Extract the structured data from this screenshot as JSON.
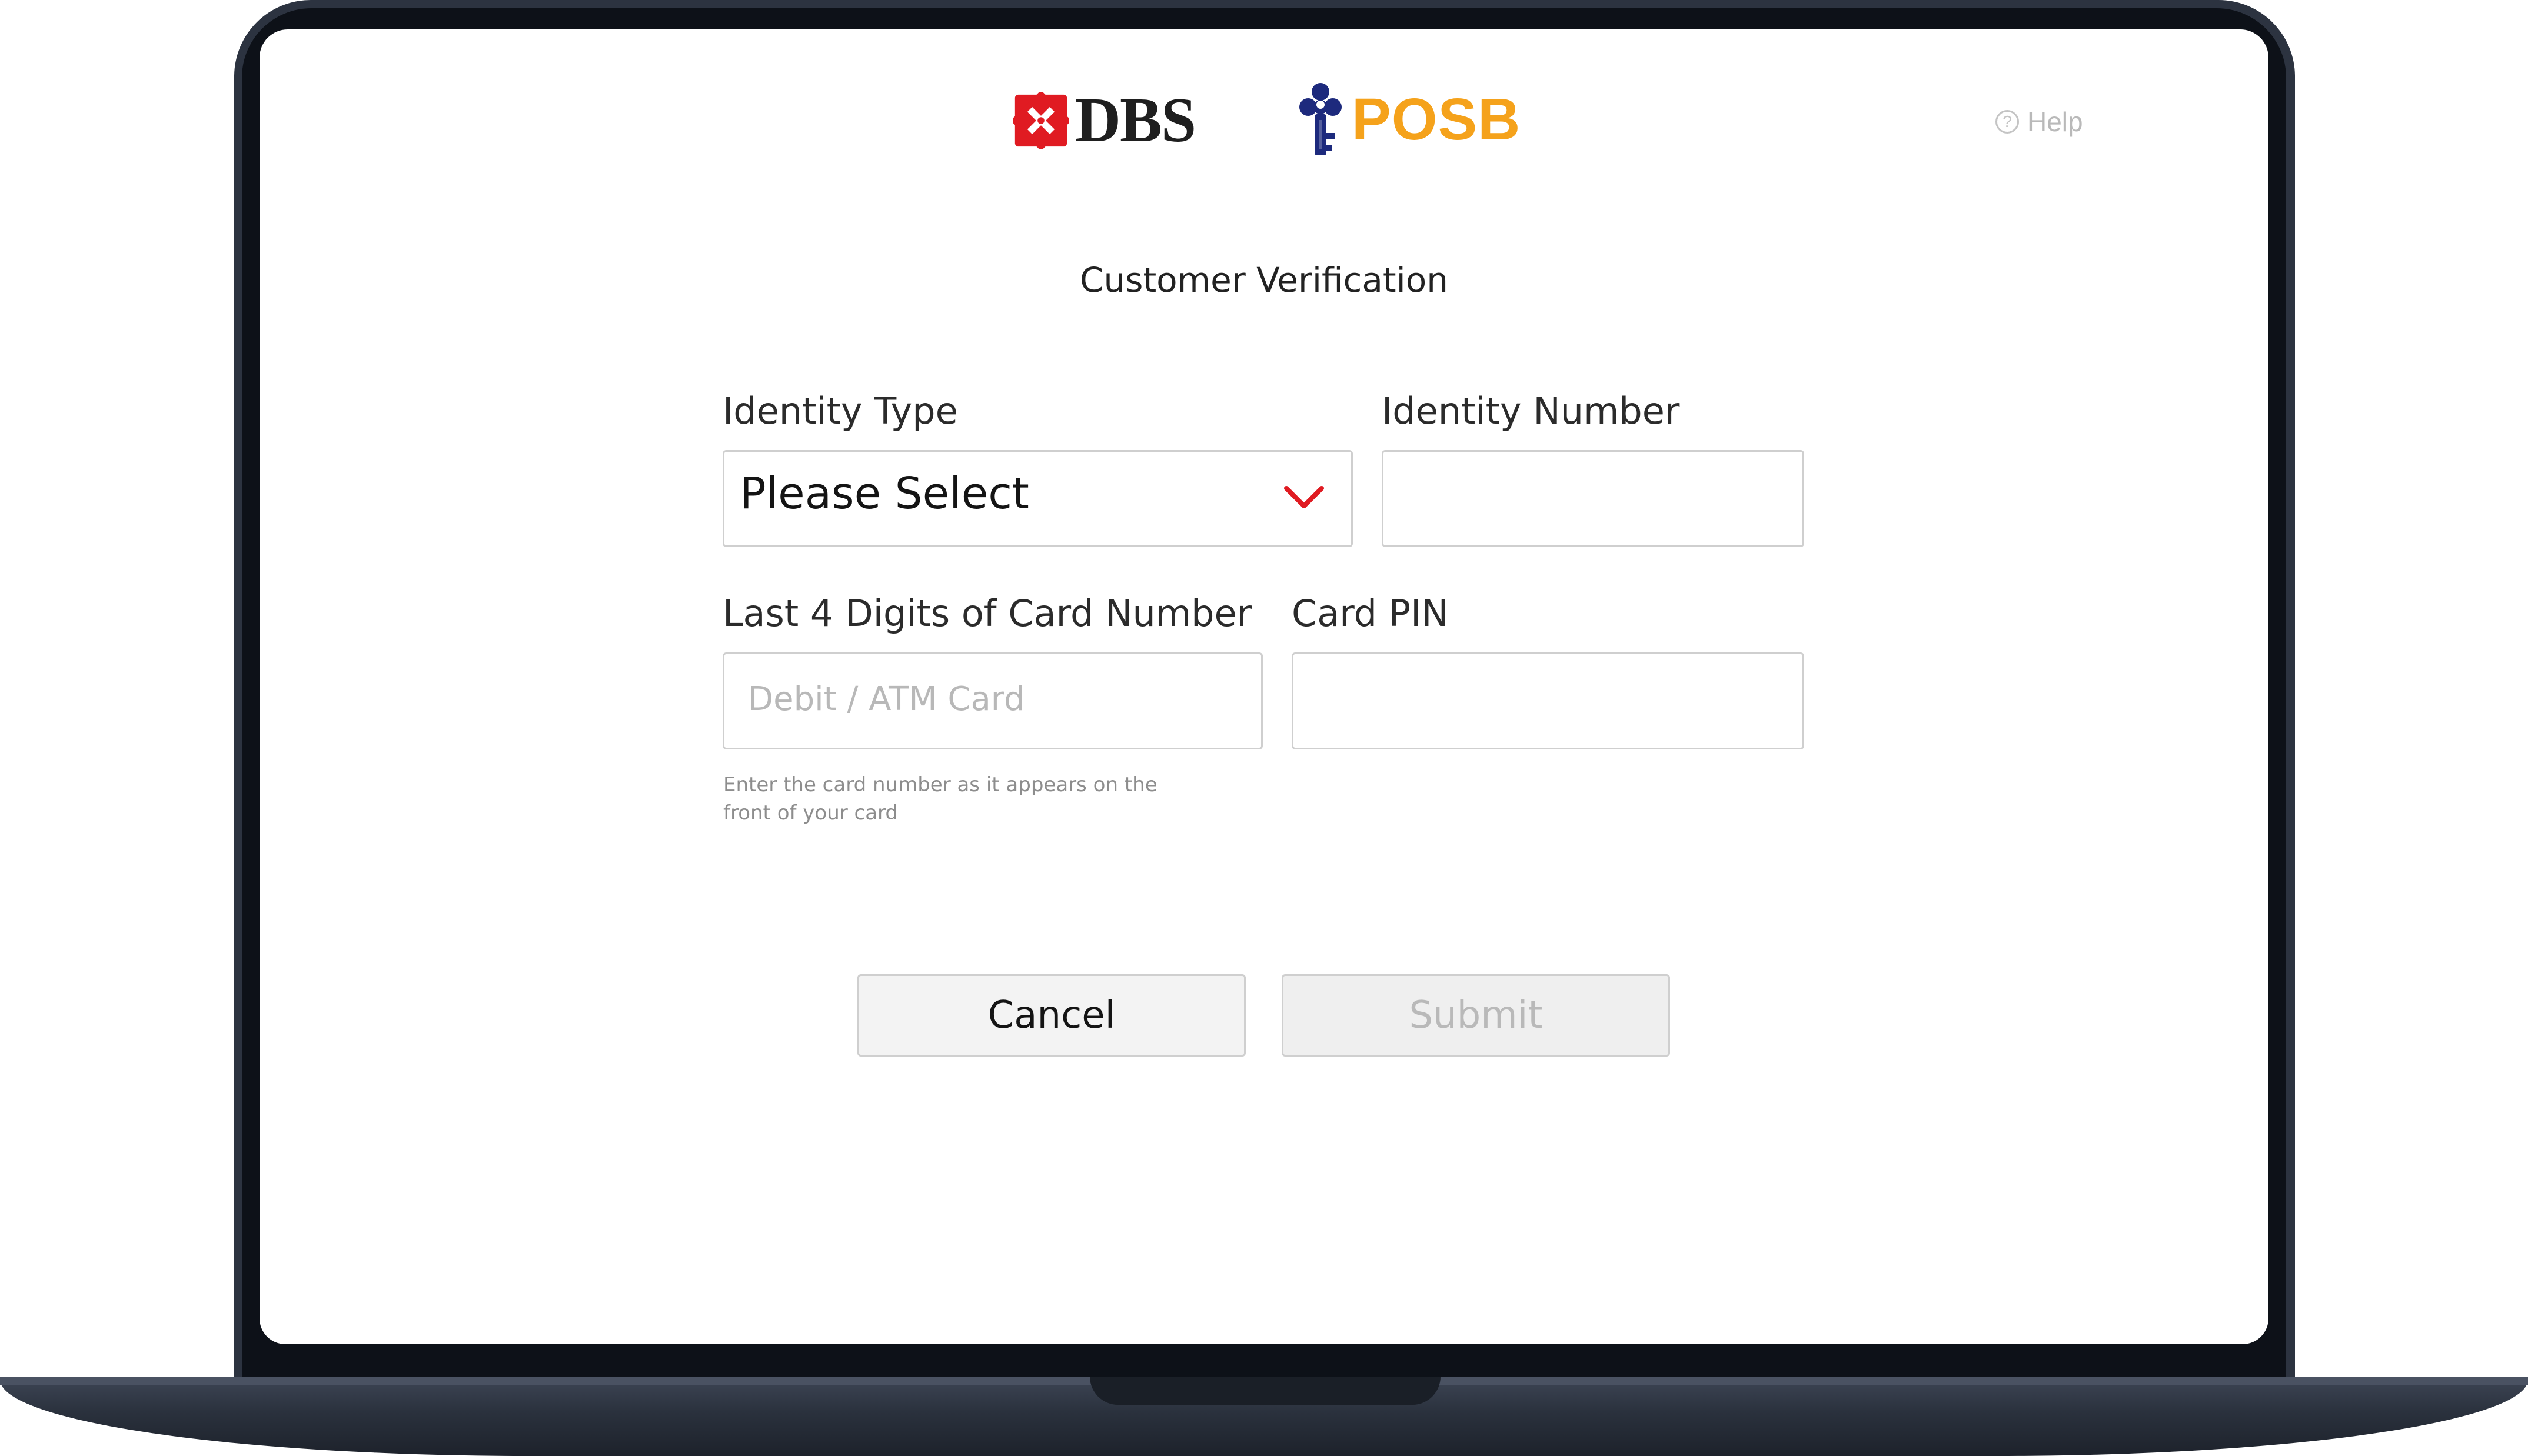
{
  "header": {
    "dbs_logo_text": "DBS",
    "posb_logo_text": "POSB",
    "help_label": "Help"
  },
  "page_title": "Customer Verification",
  "form": {
    "identity_type": {
      "label": "Identity Type",
      "selected": "Please Select"
    },
    "identity_number": {
      "label": "Identity Number",
      "value": ""
    },
    "card_last4": {
      "label": "Last 4 Digits of Card Number",
      "placeholder": "Debit / ATM Card",
      "hint": "Enter the card number as it appears on the front of your card"
    },
    "card_pin": {
      "label": "Card PIN",
      "value": ""
    }
  },
  "buttons": {
    "cancel": "Cancel",
    "submit": "Submit"
  },
  "colors": {
    "dbs_red": "#e01b22",
    "posb_orange": "#f5a21b",
    "posb_blue": "#1d2a7d",
    "chevron_red": "#e01b22",
    "bezel": "#0d1118"
  }
}
